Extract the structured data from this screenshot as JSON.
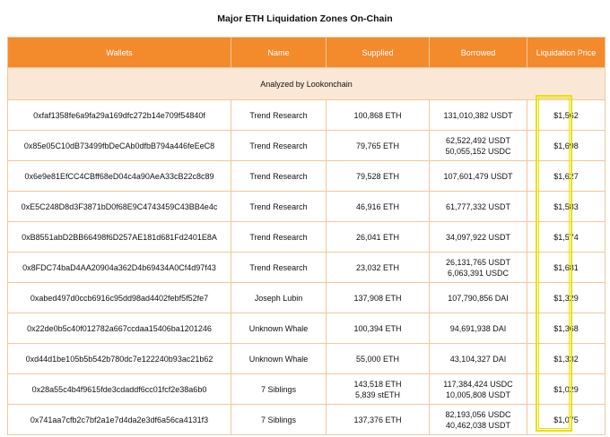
{
  "title": "Major ETH Liquidation Zones On-Chain",
  "headers": [
    "Wallets",
    "Name",
    "Supplied",
    "Borrowed",
    "Liquidation Price"
  ],
  "analyzed_by": "Analyzed by Lookonchain",
  "highlight_color": "#e8e000",
  "header_color": "#f38a2c",
  "rows": [
    {
      "wallet": "0xfaf1358fe6a9fa29a169dfc272b14e709f54840f",
      "name": "Trend Research",
      "supplied": [
        "100,868 ETH"
      ],
      "borrowed": [
        "131,010,382 USDT"
      ],
      "price": "$1,562"
    },
    {
      "wallet": "0x85e05C10dB73499fbDeCAb0dfbB794a446feEeC8",
      "name": "Trend Research",
      "supplied": [
        "79,765 ETH"
      ],
      "borrowed": [
        "62,522,492 USDT",
        "50,055,152 USDC"
      ],
      "price": "$1,698"
    },
    {
      "wallet": "0x6e9e81EfCC4CBff68eD04c4a90AeA33cB22c8c89",
      "name": "Trend Research",
      "supplied": [
        "79,528 ETH"
      ],
      "borrowed": [
        "107,601,479 USDT"
      ],
      "price": "$1,627"
    },
    {
      "wallet": "0xE5C248D8d3F3871bD0f68E9C4743459C43BB4e4c",
      "name": "Trend Research",
      "supplied": [
        "46,916 ETH"
      ],
      "borrowed": [
        "61,777,332 USDT"
      ],
      "price": "$1,583"
    },
    {
      "wallet": "0xB8551abD2BB66498f6D257AE181d681Fd2401E8A",
      "name": "Trend Research",
      "supplied": [
        "26,041 ETH"
      ],
      "borrowed": [
        "34,097,922 USDT"
      ],
      "price": "$1,574"
    },
    {
      "wallet": "0x8FDC74baD4AA20904a362D4b69434A0Cf4d97f43",
      "name": "Trend Research",
      "supplied": [
        "23,032 ETH"
      ],
      "borrowed": [
        "26,131,765 USDT",
        "6,063,391 USDC"
      ],
      "price": "$1,681"
    },
    {
      "wallet": "0xabed497d0ccb6916c95dd98ad4402febf5f52fe7",
      "name": "Joseph Lubin",
      "supplied": [
        "137,908 ETH"
      ],
      "borrowed": [
        "107,790,856 DAI"
      ],
      "price": "$1,329"
    },
    {
      "wallet": "0x22de0b5c40f012782a667ccdaa15406ba1201246",
      "name": "Unknown Whale",
      "supplied": [
        "100,394 ETH"
      ],
      "borrowed": [
        "94,691,938 DAI"
      ],
      "price": "$1,368"
    },
    {
      "wallet": "0xd44d1be105b5b542b780dc7e122240b93ac21b62",
      "name": "Unknown Whale",
      "supplied": [
        "55,000 ETH"
      ],
      "borrowed": [
        "43,104,327 DAI"
      ],
      "price": "$1,332"
    },
    {
      "wallet": "0x28a55c4b4f9615fde3cdaddf6cc01fcf2e38a6b0",
      "name": "7 Siblings",
      "supplied": [
        "143,518 ETH",
        "5,839 stETH"
      ],
      "borrowed": [
        "117,384,424 USDC",
        "10,005,808 USDT"
      ],
      "price": "$1,029"
    },
    {
      "wallet": "0x741aa7cfb2c7bf2a1e7d4da2e3df6a56ca4131f3",
      "name": "7 Siblings",
      "supplied": [
        "137,376 ETH"
      ],
      "borrowed": [
        "82,193,056 USDC",
        "40,462,038 USDT"
      ],
      "price": "$1,075"
    }
  ]
}
